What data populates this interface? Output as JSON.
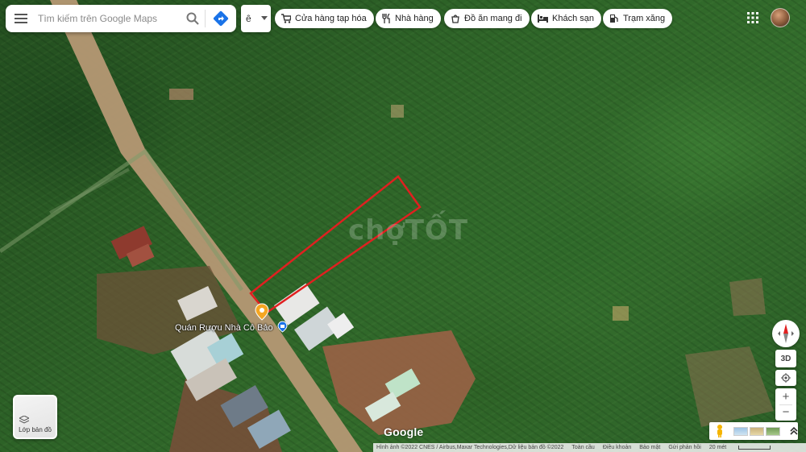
{
  "search": {
    "placeholder": "Tìm kiếm trên Google Maps"
  },
  "language": {
    "value": "ê"
  },
  "chips": [
    {
      "label": "Cửa hàng tạp hóa",
      "icon": "cart-icon"
    },
    {
      "label": "Nhà hàng",
      "icon": "fork-knife-icon"
    },
    {
      "label": "Đồ ăn mang đi",
      "icon": "takeout-icon"
    },
    {
      "label": "Khách sạn",
      "icon": "bed-icon"
    },
    {
      "label": "Trạm xăng",
      "icon": "gas-pump-icon"
    }
  ],
  "poi": {
    "label": "Quán Rượu Nhà Cô Bảo",
    "icon": "shopping-bag-icon"
  },
  "watermark": "chợTỐT",
  "layers": {
    "label": "Lớp bản đồ"
  },
  "controls": {
    "tilt_label": "3D",
    "zoom_in": "+",
    "zoom_out": "−",
    "expand": "⌃"
  },
  "brand": "Google",
  "footer": {
    "imagery": "Hình ảnh ©2022 CNES / Airbus,Maxar Technologies,Dữ liệu bản đồ ©2022",
    "links": [
      "Toàn cầu",
      "Điều khoản",
      "Bảo mật",
      "Gửi phản hồi"
    ],
    "scale": "20 mét"
  },
  "colors": {
    "boundary": "#e02020",
    "accent": "#1a73e8",
    "poi_pin": "#f5a623"
  }
}
